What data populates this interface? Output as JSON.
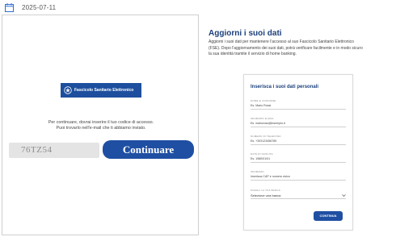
{
  "topbar": {
    "date": "2025-07-11"
  },
  "login_panel": {
    "badge_text": "Fascicolo Sanitario Elettronico",
    "instruction_line1": "Per continuare, dovrai inserire il tuo codice di accesso.",
    "instruction_line2": "Puoi trovarlo nell'e-mail che ti abbiamo inviato.",
    "code_value": "76TZ54",
    "continue_label": "Continuare"
  },
  "update_panel": {
    "title": "Aggiorni i suoi dati",
    "description_lines": [
      "Aggiorni i suoi dati per mantenere l'accesso al suo Fascicolo Sanitario Elettronico",
      "(FSE). Dopo l'aggiornamento dei suoi dati, potrà verificare facilmente e in modo sicuro",
      "la sua identità tramite il servizio di home banking."
    ]
  },
  "form": {
    "title": "Inserisca i suoi dati personali",
    "fields": [
      {
        "label": "NOME E COGNOME",
        "value": "Es. Mario Rossi"
      },
      {
        "label": "INDIRIZZO E-MAIL",
        "value": "Es. mariorossi@esempio.it"
      },
      {
        "label": "NUMERO DI TELEFONO",
        "value": "Es. +393123456789"
      },
      {
        "label": "DATA DI NASCITA",
        "value": "Es. 1980/01/01"
      },
      {
        "label": "INDIRIZZO",
        "value": "Inserisca CAP e numero civico"
      }
    ],
    "bank_select": {
      "label": "SCEGLI LA TUA BANCA",
      "value": "Selezione una banca"
    },
    "submit_label": "CONTINUA"
  },
  "colors": {
    "primary": "#1f4fa3",
    "title": "#1b3f7a"
  },
  "icons": {
    "calendar": "calendar-icon",
    "emblem": "emblem-icon",
    "chevron": "chevron-down-icon"
  }
}
